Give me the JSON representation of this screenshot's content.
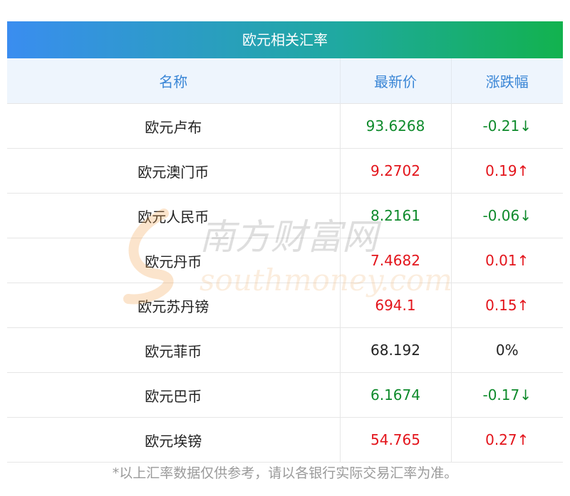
{
  "title": "欧元相关汇率",
  "headers": {
    "name": "名称",
    "price": "最新价",
    "change": "涨跌幅"
  },
  "rows": [
    {
      "name": "欧元卢布",
      "price": "93.6268",
      "change": "-0.21↓",
      "trend": "down"
    },
    {
      "name": "欧元澳门币",
      "price": "9.2702",
      "change": "0.19↑",
      "trend": "up"
    },
    {
      "name": "欧元人民币",
      "price": "8.2161",
      "change": "-0.06↓",
      "trend": "down"
    },
    {
      "name": "欧元丹币",
      "price": "7.4682",
      "change": "0.01↑",
      "trend": "up"
    },
    {
      "name": "欧元苏丹镑",
      "price": "694.1",
      "change": "0.15↑",
      "trend": "up"
    },
    {
      "name": "欧元菲币",
      "price": "68.192",
      "change": "0%",
      "trend": "flat"
    },
    {
      "name": "欧元巴币",
      "price": "6.1674",
      "change": "-0.17↓",
      "trend": "down"
    },
    {
      "name": "欧元埃镑",
      "price": "54.765",
      "change": "0.27↑",
      "trend": "up"
    }
  ],
  "note": "*以上汇率数据仅供参考，请以各银行实际交易汇率为准。",
  "watermark": {
    "cn": "南方财富网",
    "en": "southmoney.com"
  },
  "colors": {
    "up": "#e3141b",
    "down": "#0e8a2b",
    "header_text": "#3a86d6",
    "gradient_start": "#3a8df0",
    "gradient_end": "#12b24e"
  }
}
